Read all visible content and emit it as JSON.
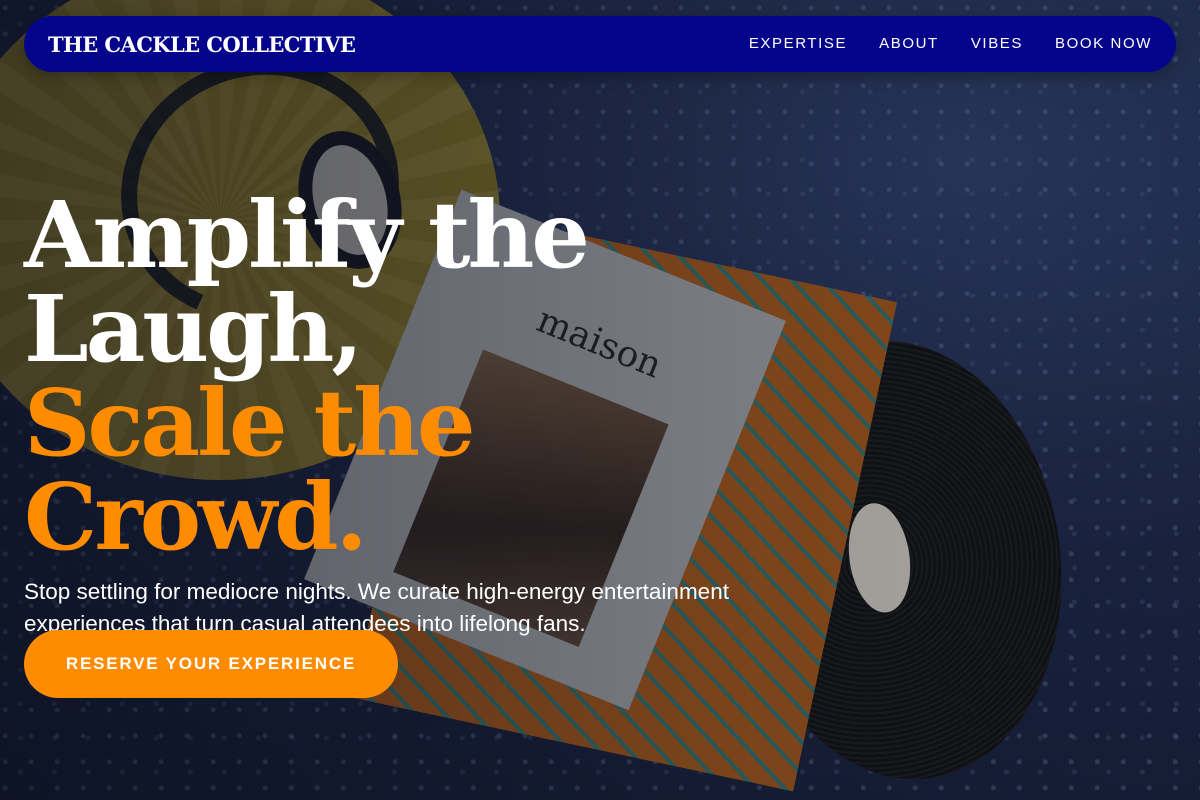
{
  "brand": {
    "name": "THE CACKLE COLLECTIVE"
  },
  "nav": {
    "items": [
      {
        "label": "EXPERTISE"
      },
      {
        "label": "ABOUT"
      },
      {
        "label": "VIBES"
      },
      {
        "label": "BOOK NOW"
      }
    ]
  },
  "hero": {
    "headline_line1": "Amplify the",
    "headline_line2": "Laugh,",
    "headline_line3": "Scale the Crowd.",
    "subtitle": "Stop settling for mediocre nights. We curate high-energy entertainment experiences that turn casual attendees into lifelong fans.",
    "cta_label": "RESERVE YOUR EXPERIENCE"
  },
  "background": {
    "magazine_title": "maison"
  },
  "colors": {
    "navbar": "#05058c",
    "accent": "#ff8c00",
    "text": "#ffffff"
  }
}
